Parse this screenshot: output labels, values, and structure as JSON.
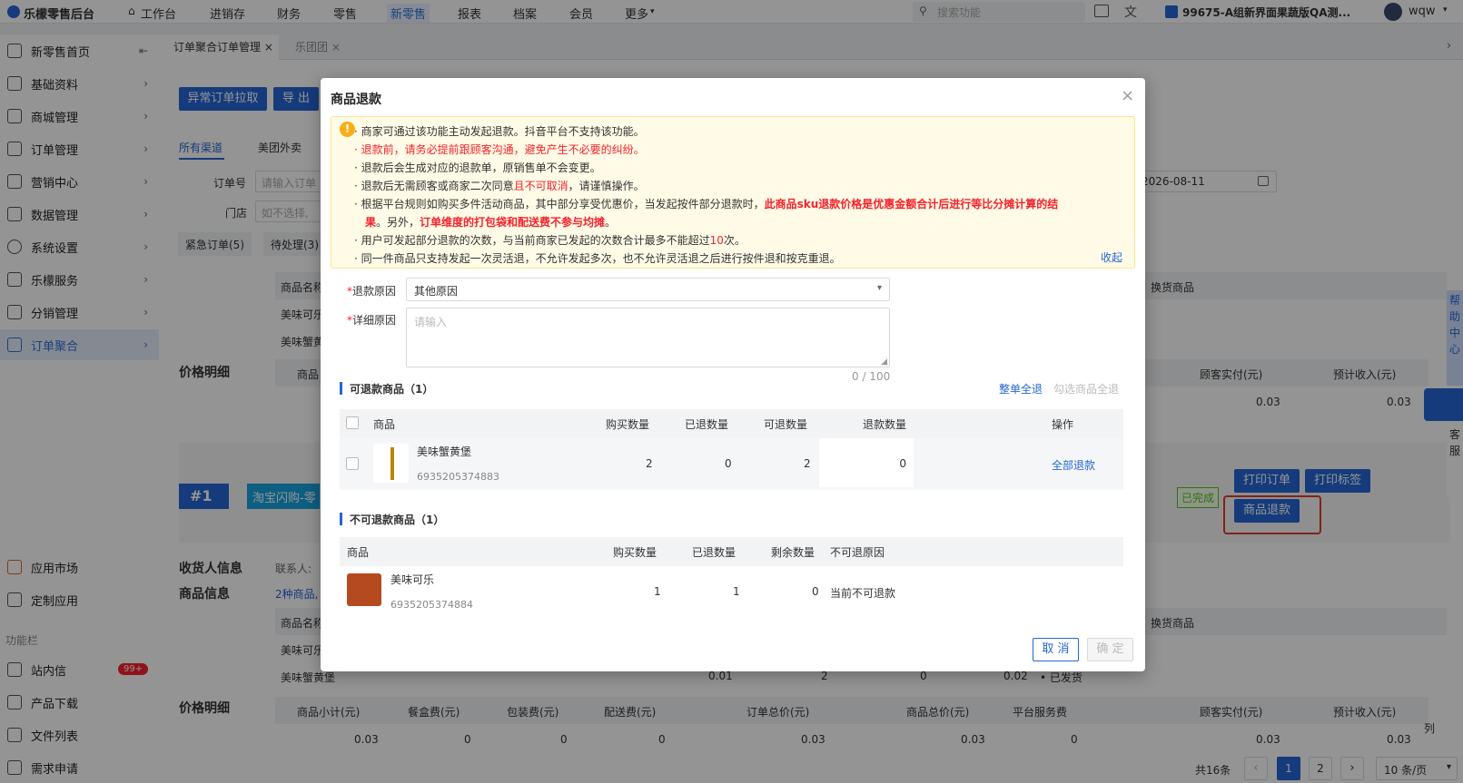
{
  "topbar": {
    "brand": "乐檬零售后台",
    "nav": [
      "工作台",
      "进销存",
      "财务",
      "零售",
      "新零售",
      "报表",
      "档案",
      "会员",
      "更多"
    ],
    "search_placeholder": "搜索功能",
    "store": "99675-A组新界面果蔬版QA测...",
    "user": "wqw"
  },
  "sidebar": {
    "items": [
      "新零售首页",
      "基础资料",
      "商城管理",
      "订单管理",
      "营销中心",
      "数据管理",
      "系统设置",
      "乐檬服务",
      "分销管理",
      "订单聚合"
    ],
    "lower": [
      "应用市场",
      "定制应用"
    ],
    "section": "功能栏",
    "bottom": [
      "站内信",
      "产品下载",
      "文件列表",
      "需求申请"
    ],
    "badge": "99+"
  },
  "tabs": [
    "订单聚合订单管理",
    "乐团团"
  ],
  "page": {
    "btn_abnormal": "异常订单拉取",
    "btn_export": "导 出",
    "channel_tabs": [
      "所有渠道",
      "美团外卖"
    ],
    "order_no_label": "订单号",
    "order_no_placeholder": "请输入订单",
    "store_label": "门店",
    "store_placeholder": "如不选择,",
    "date_value": "2026-08-11",
    "status_tabs": [
      "紧急订单(5)",
      "待处理(3)"
    ],
    "col_product_name": "商品名称",
    "col_exchange": "换货商品",
    "rows": [
      "美味可乐",
      "美味蟹黄堡"
    ],
    "price_title": "价格明细",
    "col_goods": "商品",
    "col_customer_paid": "顾客实付(元)",
    "col_expected": "预计收入(元)",
    "val_customer": "0.03",
    "val_expected": "0.03",
    "order_index": "#1",
    "channel_badge": "淘宝闪购-零",
    "btn_print_order": "打印订单",
    "btn_print_label": "打印标签",
    "btn_refund": "商品退款",
    "status_done": "已完成",
    "receiver_title": "收货人信息",
    "contact_label": "联系人:",
    "goods_info_title": "商品信息",
    "goods_count": "2种商品,",
    "b_price": "0.01",
    "b_qty": "2",
    "b_refund": "0",
    "b_total": "0.02",
    "b_status": "• 已发货",
    "price_cols": [
      "商品小计(元)",
      "餐盒费(元)",
      "包装费(元)",
      "配送费(元)",
      "订单总价(元)",
      "商品总价(元)",
      "平台服务费",
      "顾客实付(元)",
      "预计收入(元)"
    ],
    "price_vals": [
      "0.03",
      "0",
      "0",
      "0",
      "0.03",
      "0.03",
      "0",
      "0.03",
      "0.03"
    ],
    "total": "共16条",
    "pages": [
      "1",
      "2"
    ],
    "page_size": "10 条/页",
    "col_text": "列",
    "help": "帮助中心",
    "service": "客服"
  },
  "modal": {
    "title": "商品退款",
    "notices": [
      "· 商家可通过该功能主动发起退款。抖音平台不支持该功能。",
      "· 退款前，请务必提前跟顾客沟通，避免产生不必要的纠纷。",
      "· 退款后会生成对应的退款单，原销售单不会变更。",
      "· 退款后无需顾客或商家二次同意",
      "且不可取消",
      "，请谨慎操作。",
      "· 根据平台规则如购买多件活动商品，其中部分享受优惠价，当发起按件部分退款时，",
      "此商品sku退款价格是优惠金额合计后进行等比分摊计算的结",
      "果",
      "。另外，",
      "订单维度的打包袋和配送费不参与均摊",
      "。",
      "· 用户可发起部分退款的次数，与当前商家已发起的次数合计最多不能超过",
      "10",
      "次。",
      "· 同一件商品只支持发起一次灵活退，不允许发起多次，也不允许灵活退之后进行按件退和按克重退。"
    ],
    "collapse": "收起",
    "reason_label": "退款原因",
    "reason_value": "其他原因",
    "detail_label": "详细原因",
    "detail_placeholder": "请输入",
    "detail_count": "0 / 100",
    "refundable_title": "可退款商品（1）",
    "select_all": "整单全退",
    "select_goods_all": "勾选商品全退",
    "ref_cols": [
      "商品",
      "购买数量",
      "已退数量",
      "可退数量",
      "退款数量",
      "操作"
    ],
    "ref_row": {
      "name": "美味蟹黄堡",
      "sku": "6935205374883",
      "buy": "2",
      "refunded": "0",
      "refundable": "2",
      "qty": "0",
      "action": "全部退款"
    },
    "nonref_title": "不可退款商品（1）",
    "non_cols": [
      "商品",
      "购买数量",
      "已退数量",
      "剩余数量",
      "不可退原因"
    ],
    "non_row": {
      "name": "美味可乐",
      "sku": "6935205374884",
      "buy": "1",
      "refunded": "1",
      "remain": "0",
      "reason": "当前不可退款"
    },
    "cancel": "取 消",
    "confirm": "确 定"
  },
  "colors": {
    "primary": "#2567d6",
    "danger": "#f5222d",
    "warning_bg": "#fffbe6"
  }
}
